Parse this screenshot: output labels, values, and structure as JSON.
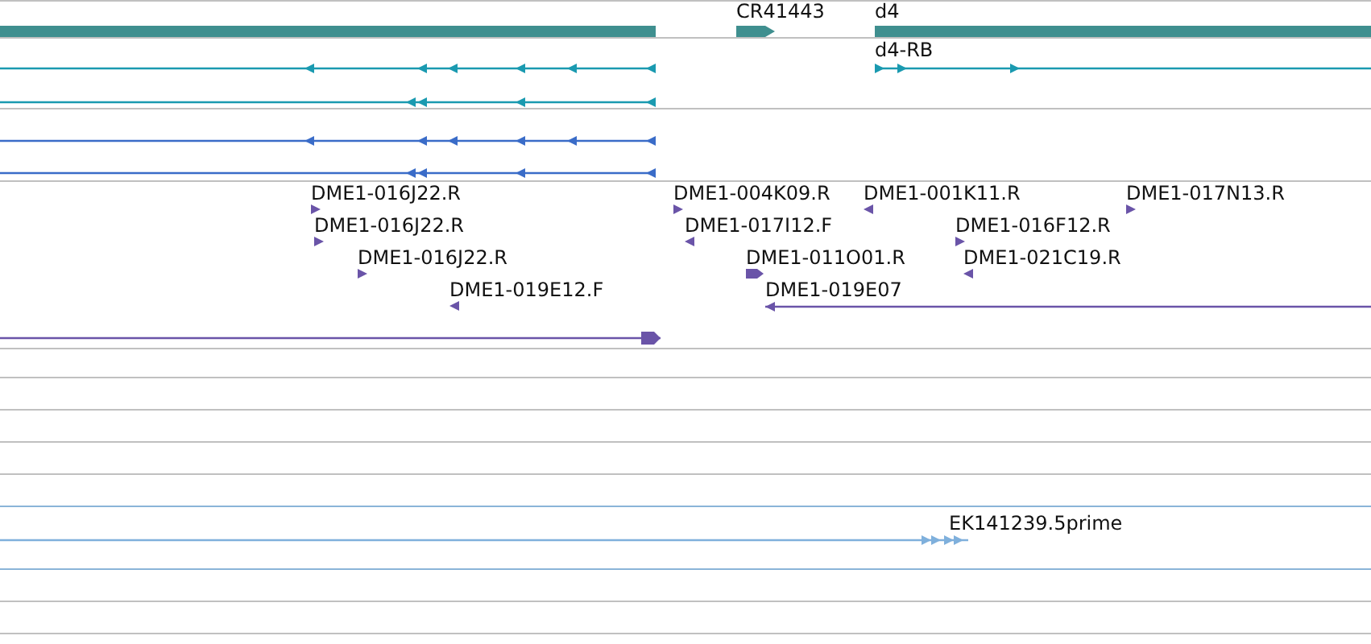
{
  "tracks": [
    {
      "kind": "features",
      "color": "#3f8f8f",
      "features": [
        {
          "kind": "bar"
        },
        {
          "kind": "bar",
          "label": "CR41443",
          "reverse": false
        },
        {
          "kind": "bar",
          "label": "d4"
        }
      ]
    },
    {
      "kind": "features",
      "color": "#1a9ab0",
      "features": [
        {
          "kind": "transcript",
          "reverse": true
        },
        {
          "kind": "transcript",
          "reverse": true
        },
        {
          "kind": "transcript",
          "label": "d4-RB",
          "reverse": false
        }
      ]
    },
    {
      "kind": "features",
      "color": "#3a6cc8",
      "features": [
        {
          "kind": "transcript",
          "reverse": true
        },
        {
          "kind": "transcript",
          "reverse": true
        }
      ]
    },
    {
      "kind": "features",
      "color": "#6a54a8",
      "features": [
        {
          "kind": "marker",
          "label": "DME1-016J22.R",
          "reverse": false
        },
        {
          "kind": "marker",
          "label": "DME1-004K09.R",
          "reverse": false
        },
        {
          "kind": "marker",
          "label": "DME1-001K11.R",
          "reverse": true
        },
        {
          "kind": "marker",
          "label": "DME1-017N13.R",
          "reverse": false
        },
        {
          "kind": "marker",
          "label": "DME1-016J22.R",
          "reverse": false
        },
        {
          "kind": "marker",
          "label": "DME1-017I12.F",
          "reverse": true
        },
        {
          "kind": "marker",
          "label": "DME1-016F12.R",
          "reverse": false
        },
        {
          "kind": "marker",
          "label": "DME1-016J22.R",
          "reverse": false
        },
        {
          "kind": "marker",
          "label": "DME1-011O01.R",
          "reverse": false
        },
        {
          "kind": "marker",
          "label": "DME1-021C19.R",
          "reverse": true
        },
        {
          "kind": "marker",
          "label": "DME1-019E12.F",
          "reverse": true
        },
        {
          "kind": "transcript",
          "label": "DME1-019E07",
          "reverse": true
        },
        {
          "kind": "transcript",
          "reverse": false
        }
      ]
    },
    {
      "kind": "empty"
    },
    {
      "kind": "empty"
    },
    {
      "kind": "empty"
    },
    {
      "kind": "empty"
    },
    {
      "kind": "empty"
    },
    {
      "kind": "features",
      "color": "#7fb0dc",
      "features": [
        {
          "kind": "transcript",
          "label": "EK141239.5prime",
          "reverse": false
        }
      ]
    },
    {
      "kind": "empty"
    },
    {
      "kind": "empty"
    }
  ]
}
